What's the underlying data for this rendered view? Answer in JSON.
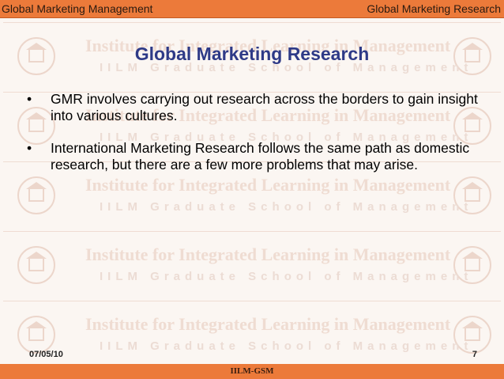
{
  "header": {
    "left_text": "Global Marketing Management",
    "right_text": "Global Marketing Research"
  },
  "watermark": {
    "line1": "Institute for Integrated Learning in Management",
    "line2": "IILM Graduate School of Management",
    "logo_text": "IILM"
  },
  "slide": {
    "title": "Global Marketing Research",
    "bullets": [
      "GMR involves carrying out research across the borders to gain insight into various cultures.",
      "International Marketing Research follows the same path as domestic research, but there are a few more problems that may arise."
    ]
  },
  "footer": {
    "date": "07/05/10",
    "page": "7",
    "org": "IILM-GSM"
  },
  "colors": {
    "bar": "#ec7a3a",
    "title": "#2e3a87",
    "background": "#fbf6f2"
  }
}
